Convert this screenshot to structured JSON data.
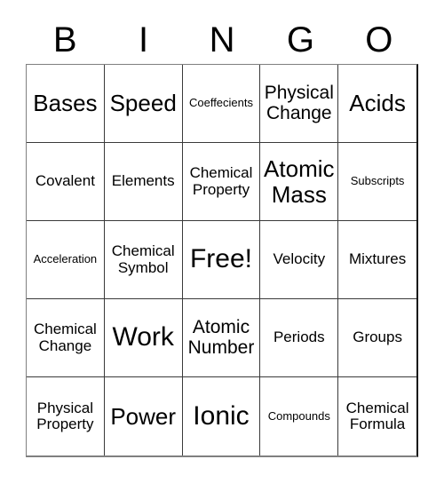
{
  "header": {
    "letters": [
      "B",
      "I",
      "N",
      "G",
      "O"
    ]
  },
  "grid": {
    "rows": 5,
    "columns": 5,
    "cells": [
      {
        "text": "Bases",
        "size": "s-lg"
      },
      {
        "text": "Speed",
        "size": "s-lg"
      },
      {
        "text": "Coeffecients",
        "size": "s-xs"
      },
      {
        "text": "Physical\nChange",
        "size": "s-md"
      },
      {
        "text": "Acids",
        "size": "s-lg"
      },
      {
        "text": "Covalent",
        "size": "s-sm"
      },
      {
        "text": "Elements",
        "size": "s-sm"
      },
      {
        "text": "Chemical\nProperty",
        "size": "s-sm"
      },
      {
        "text": "Atomic\nMass",
        "size": "s-lg"
      },
      {
        "text": "Subscripts",
        "size": "s-xs"
      },
      {
        "text": "Acceleration",
        "size": "s-xs"
      },
      {
        "text": "Chemical\nSymbol",
        "size": "s-sm"
      },
      {
        "text": "Free!",
        "size": "s-xl"
      },
      {
        "text": "Velocity",
        "size": "s-sm"
      },
      {
        "text": "Mixtures",
        "size": "s-sm"
      },
      {
        "text": "Chemical\nChange",
        "size": "s-sm"
      },
      {
        "text": "Work",
        "size": "s-xl"
      },
      {
        "text": "Atomic\nNumber",
        "size": "s-md"
      },
      {
        "text": "Periods",
        "size": "s-sm"
      },
      {
        "text": "Groups",
        "size": "s-sm"
      },
      {
        "text": "Physical\nProperty",
        "size": "s-sm"
      },
      {
        "text": "Power",
        "size": "s-lg"
      },
      {
        "text": "Ionic",
        "size": "s-xl"
      },
      {
        "text": "Compounds",
        "size": "s-xs"
      },
      {
        "text": "Chemical\nFormula",
        "size": "s-sm"
      }
    ]
  },
  "colors": {
    "background": "#ffffff",
    "text": "#000000",
    "grid_line": "#3a3a3a",
    "outer_border": "#808080"
  }
}
